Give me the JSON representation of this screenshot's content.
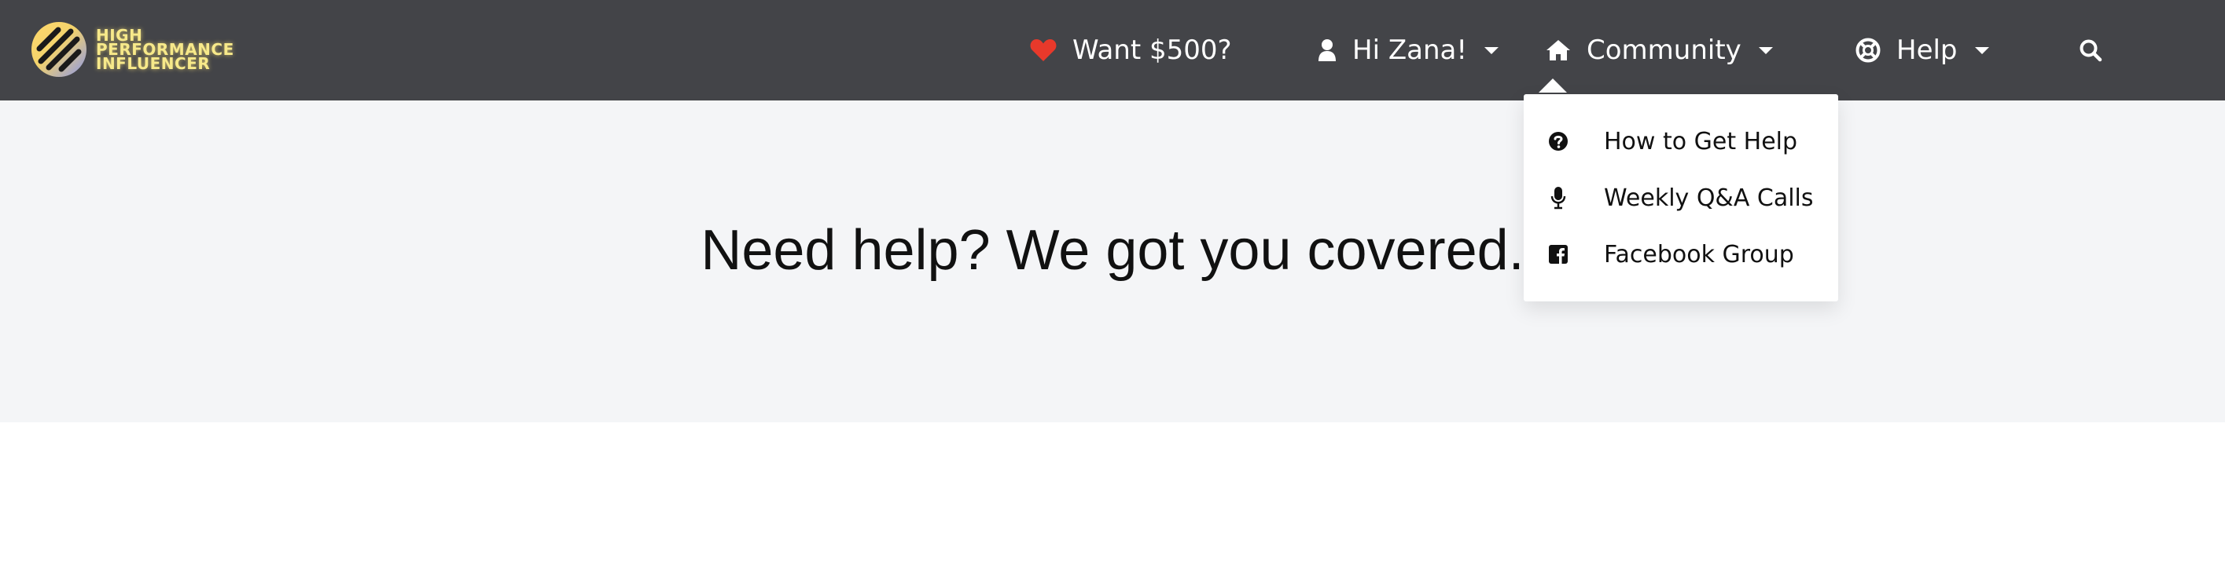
{
  "brand": {
    "logo_lines": [
      "HIGH",
      "PERFORMANCE",
      "INFLUENCER"
    ],
    "colors": {
      "navbar": "#434448",
      "logo_text": "#f7e98a",
      "heart": "#e8392b",
      "hero_bg": "#f4f5f7"
    }
  },
  "nav": {
    "referral": {
      "label": "Want $500?",
      "icon": "heart-icon"
    },
    "user": {
      "label": "Hi Zana!",
      "icon": "user-icon"
    },
    "community": {
      "label": "Community",
      "icon": "home-icon"
    },
    "help": {
      "label": "Help",
      "icon": "lifebuoy-icon"
    },
    "search": {
      "icon": "search-icon"
    }
  },
  "dropdown": {
    "items": [
      {
        "label": "How to Get Help",
        "icon": "question-circle-icon"
      },
      {
        "label": "Weekly Q&A Calls",
        "icon": "microphone-icon"
      },
      {
        "label": "Facebook Group",
        "icon": "facebook-square-icon"
      }
    ]
  },
  "hero": {
    "title": "Need help? We got you covered."
  }
}
